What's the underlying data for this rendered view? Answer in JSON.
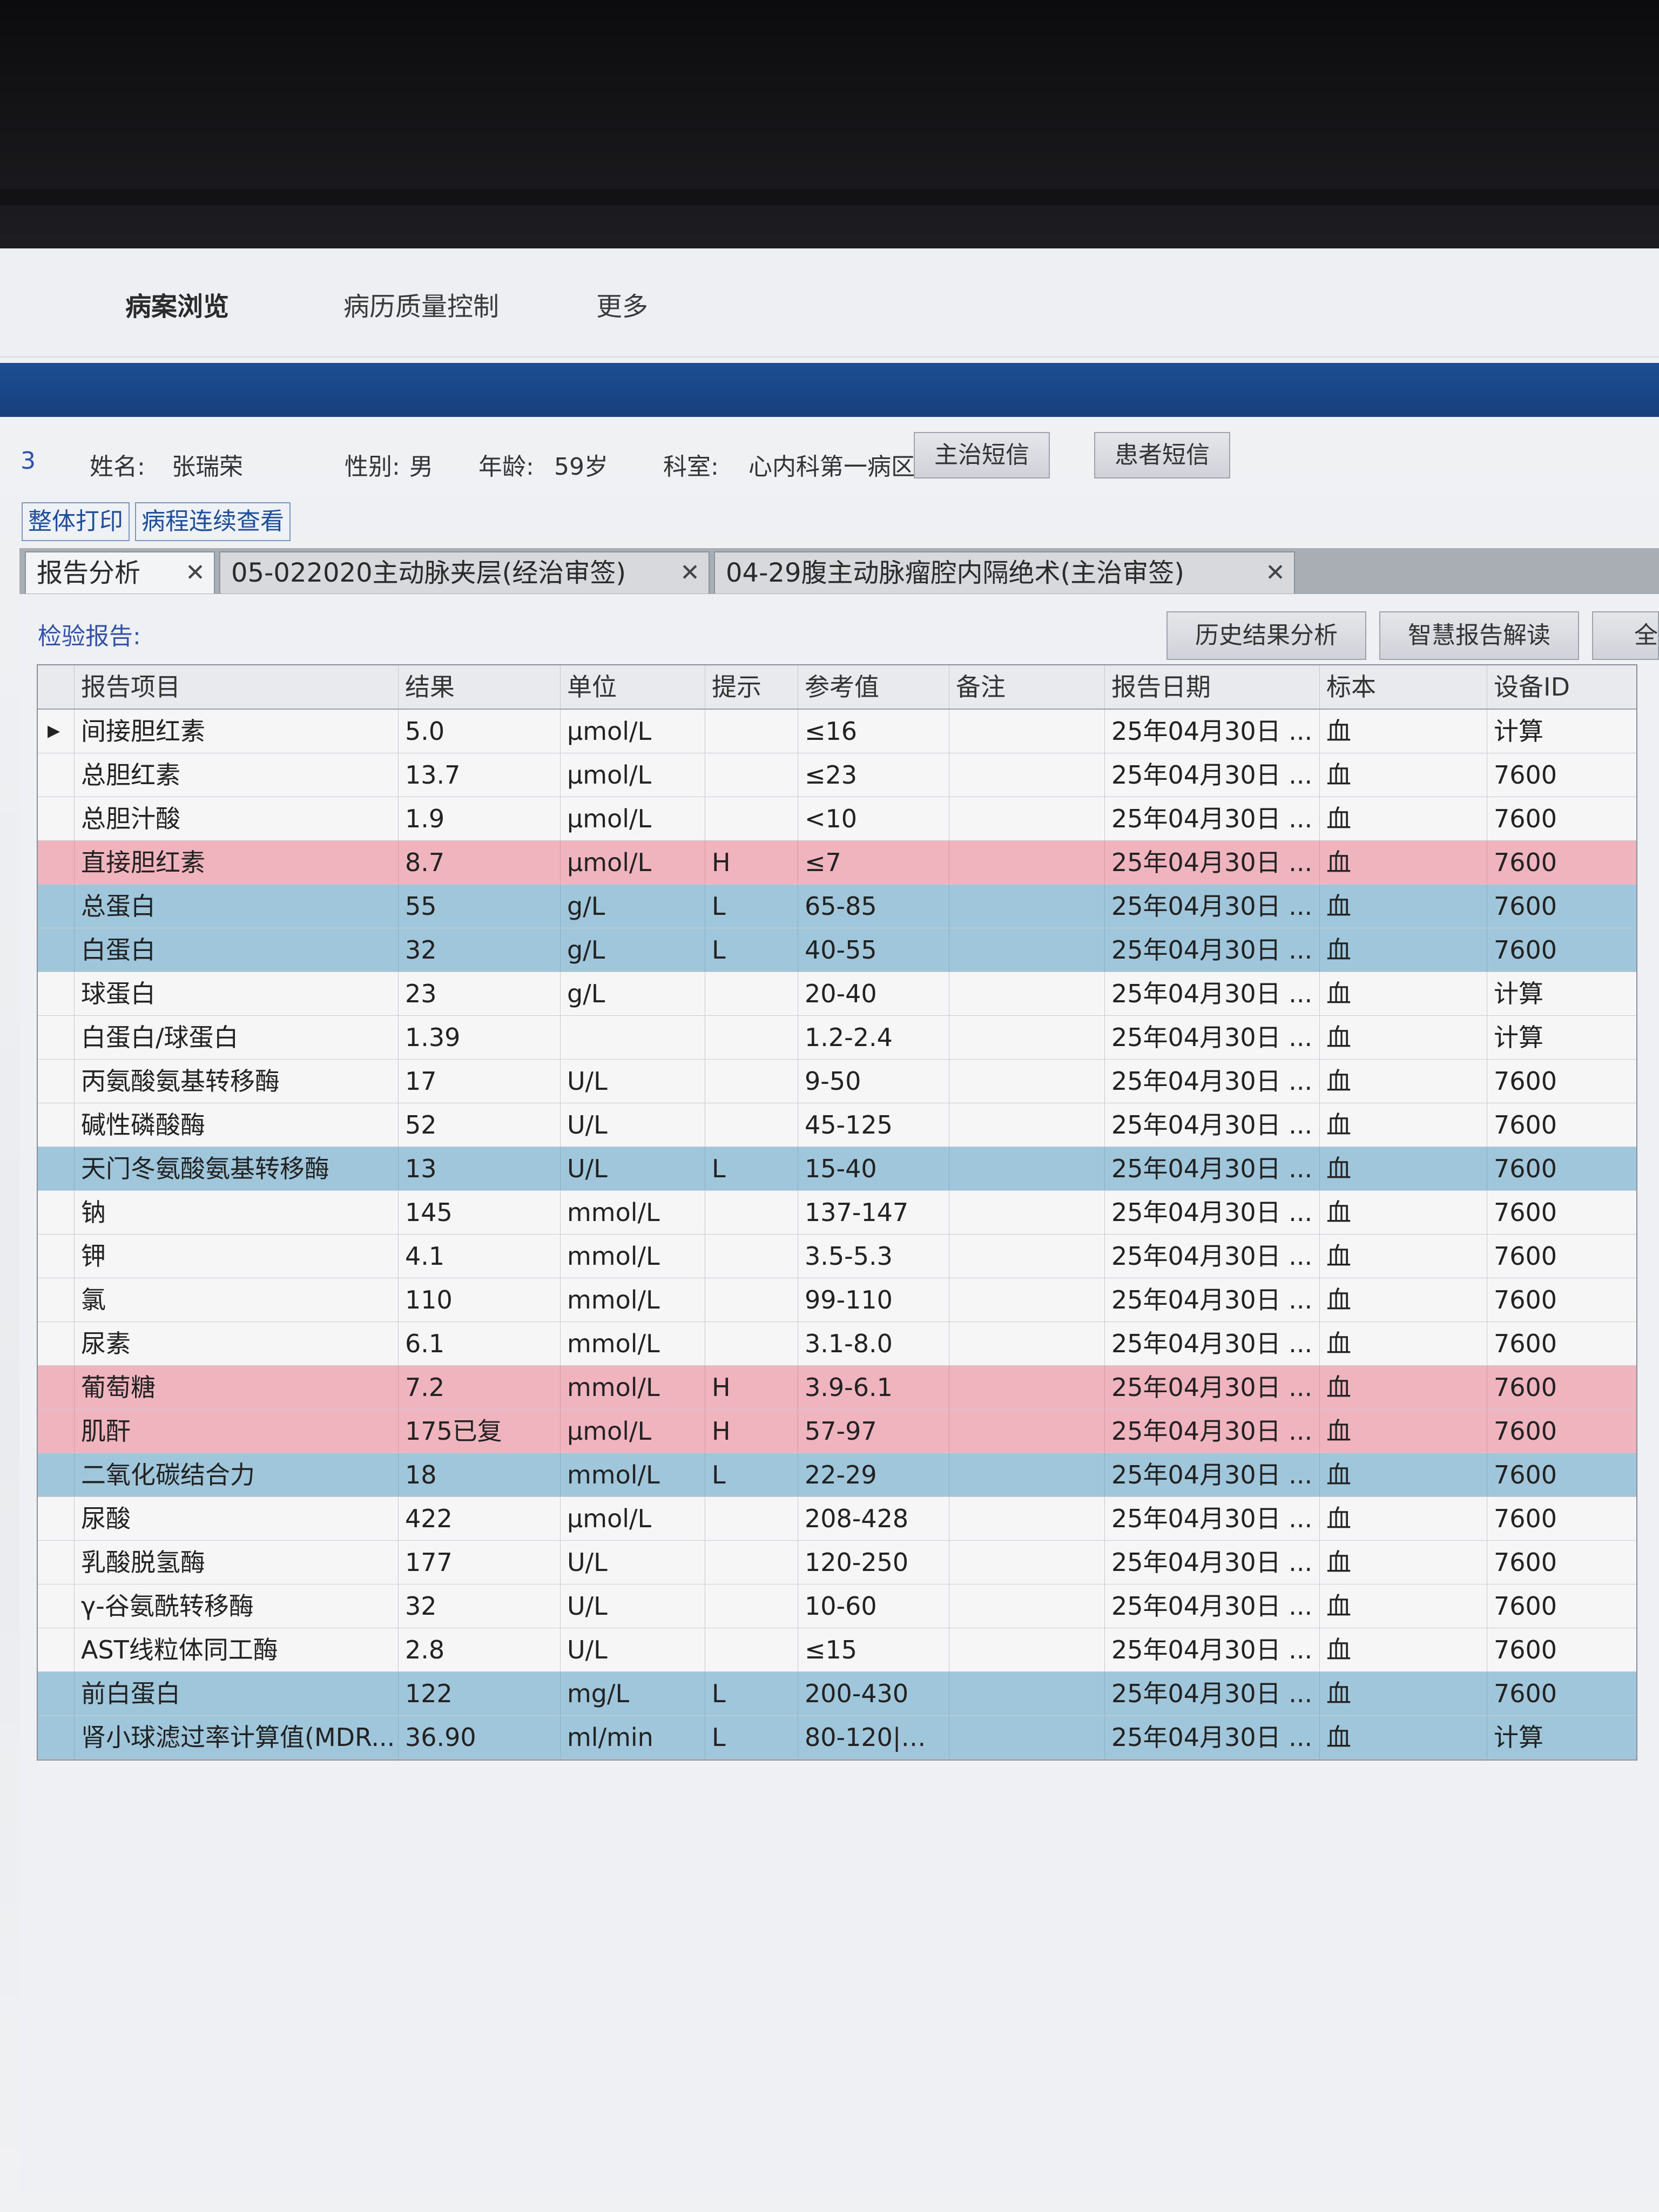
{
  "menu": {
    "items": [
      "病案浏览",
      "病历质量控制",
      "更多"
    ]
  },
  "patient": {
    "id_fragment": "3",
    "name_label": "姓名:",
    "name": "张瑞荣",
    "gender_label": "性别:",
    "gender": "男",
    "age_label": "年龄:",
    "age": "59岁",
    "dept_label": "科室:",
    "dept": "心内科第一病区",
    "sms_doctor": "主治短信",
    "sms_patient": "患者短信"
  },
  "toolbar": {
    "print_all": "整体打印",
    "course_view": "病程连续查看"
  },
  "tabs": [
    {
      "label": "报告分析"
    },
    {
      "label": "05-022020主动脉夹层(经治审签)"
    },
    {
      "label": "04-29腹主动脉瘤腔内隔绝术(主治审签)"
    }
  ],
  "tab_close_glyph": "✕",
  "report": {
    "title": "检验报告:",
    "btn_history": "历史结果分析",
    "btn_smart": "智慧报告解读",
    "btn_all": "全"
  },
  "table": {
    "headers": {
      "item": "报告项目",
      "result": "结果",
      "unit": "单位",
      "flag": "提示",
      "ref": "参考值",
      "note": "备注",
      "date": "报告日期",
      "specimen": "标本",
      "device": "设备ID"
    },
    "current_row_marker": "▶",
    "rows": [
      {
        "item": "间接胆红素",
        "result": "5.0",
        "unit": "µmol/L",
        "flag": "",
        "ref": "≤16",
        "date": "25年04月30日 ...",
        "specimen": "血",
        "device": "计算"
      },
      {
        "item": "总胆红素",
        "result": "13.7",
        "unit": "µmol/L",
        "flag": "",
        "ref": "≤23",
        "date": "25年04月30日 ...",
        "specimen": "血",
        "device": "7600"
      },
      {
        "item": "总胆汁酸",
        "result": "1.9",
        "unit": "µmol/L",
        "flag": "",
        "ref": "<10",
        "date": "25年04月30日 ...",
        "specimen": "血",
        "device": "7600"
      },
      {
        "item": "直接胆红素",
        "result": "8.7",
        "unit": "µmol/L",
        "flag": "H",
        "ref": "≤7",
        "date": "25年04月30日 ...",
        "specimen": "血",
        "device": "7600"
      },
      {
        "item": "总蛋白",
        "result": "55",
        "unit": "g/L",
        "flag": "L",
        "ref": "65-85",
        "date": "25年04月30日 ...",
        "specimen": "血",
        "device": "7600"
      },
      {
        "item": "白蛋白",
        "result": "32",
        "unit": "g/L",
        "flag": "L",
        "ref": "40-55",
        "date": "25年04月30日 ...",
        "specimen": "血",
        "device": "7600"
      },
      {
        "item": "球蛋白",
        "result": "23",
        "unit": "g/L",
        "flag": "",
        "ref": "20-40",
        "date": "25年04月30日 ...",
        "specimen": "血",
        "device": "计算"
      },
      {
        "item": "白蛋白/球蛋白",
        "result": "1.39",
        "unit": "",
        "flag": "",
        "ref": "1.2-2.4",
        "date": "25年04月30日 ...",
        "specimen": "血",
        "device": "计算"
      },
      {
        "item": "丙氨酸氨基转移酶",
        "result": "17",
        "unit": "U/L",
        "flag": "",
        "ref": "9-50",
        "date": "25年04月30日 ...",
        "specimen": "血",
        "device": "7600"
      },
      {
        "item": "碱性磷酸酶",
        "result": "52",
        "unit": "U/L",
        "flag": "",
        "ref": "45-125",
        "date": "25年04月30日 ...",
        "specimen": "血",
        "device": "7600"
      },
      {
        "item": "天门冬氨酸氨基转移酶",
        "result": "13",
        "unit": "U/L",
        "flag": "L",
        "ref": "15-40",
        "date": "25年04月30日 ...",
        "specimen": "血",
        "device": "7600"
      },
      {
        "item": "钠",
        "result": "145",
        "unit": "mmol/L",
        "flag": "",
        "ref": "137-147",
        "date": "25年04月30日 ...",
        "specimen": "血",
        "device": "7600"
      },
      {
        "item": "钾",
        "result": "4.1",
        "unit": "mmol/L",
        "flag": "",
        "ref": "3.5-5.3",
        "date": "25年04月30日 ...",
        "specimen": "血",
        "device": "7600"
      },
      {
        "item": "氯",
        "result": "110",
        "unit": "mmol/L",
        "flag": "",
        "ref": "99-110",
        "date": "25年04月30日 ...",
        "specimen": "血",
        "device": "7600"
      },
      {
        "item": "尿素",
        "result": "6.1",
        "unit": "mmol/L",
        "flag": "",
        "ref": "3.1-8.0",
        "date": "25年04月30日 ...",
        "specimen": "血",
        "device": "7600"
      },
      {
        "item": "葡萄糖",
        "result": "7.2",
        "unit": "mmol/L",
        "flag": "H",
        "ref": "3.9-6.1",
        "date": "25年04月30日 ...",
        "specimen": "血",
        "device": "7600"
      },
      {
        "item": "肌酐",
        "result": "175已复",
        "unit": "µmol/L",
        "flag": "H",
        "ref": "57-97",
        "date": "25年04月30日 ...",
        "specimen": "血",
        "device": "7600"
      },
      {
        "item": "二氧化碳结合力",
        "result": "18",
        "unit": "mmol/L",
        "flag": "L",
        "ref": "22-29",
        "date": "25年04月30日 ...",
        "specimen": "血",
        "device": "7600"
      },
      {
        "item": "尿酸",
        "result": "422",
        "unit": "µmol/L",
        "flag": "",
        "ref": "208-428",
        "date": "25年04月30日 ...",
        "specimen": "血",
        "device": "7600"
      },
      {
        "item": "乳酸脱氢酶",
        "result": "177",
        "unit": "U/L",
        "flag": "",
        "ref": "120-250",
        "date": "25年04月30日 ...",
        "specimen": "血",
        "device": "7600"
      },
      {
        "item": "γ-谷氨酰转移酶",
        "result": "32",
        "unit": "U/L",
        "flag": "",
        "ref": "10-60",
        "date": "25年04月30日 ...",
        "specimen": "血",
        "device": "7600"
      },
      {
        "item": "AST线粒体同工酶",
        "result": "2.8",
        "unit": "U/L",
        "flag": "",
        "ref": "≤15",
        "date": "25年04月30日 ...",
        "specimen": "血",
        "device": "7600"
      },
      {
        "item": "前白蛋白",
        "result": "122",
        "unit": "mg/L",
        "flag": "L",
        "ref": "200-430",
        "date": "25年04月30日 ...",
        "specimen": "血",
        "device": "7600"
      },
      {
        "item": "肾小球滤过率计算值(MDR...",
        "result": "36.90",
        "unit": "ml/min",
        "flag": "L",
        "ref": "80-120|计...",
        "date": "25年04月30日 ...",
        "specimen": "血",
        "device": "计算"
      }
    ]
  },
  "colors": {
    "high_row": "#efb4be",
    "low_row": "#9fc6da",
    "band": "#1d4e94"
  }
}
